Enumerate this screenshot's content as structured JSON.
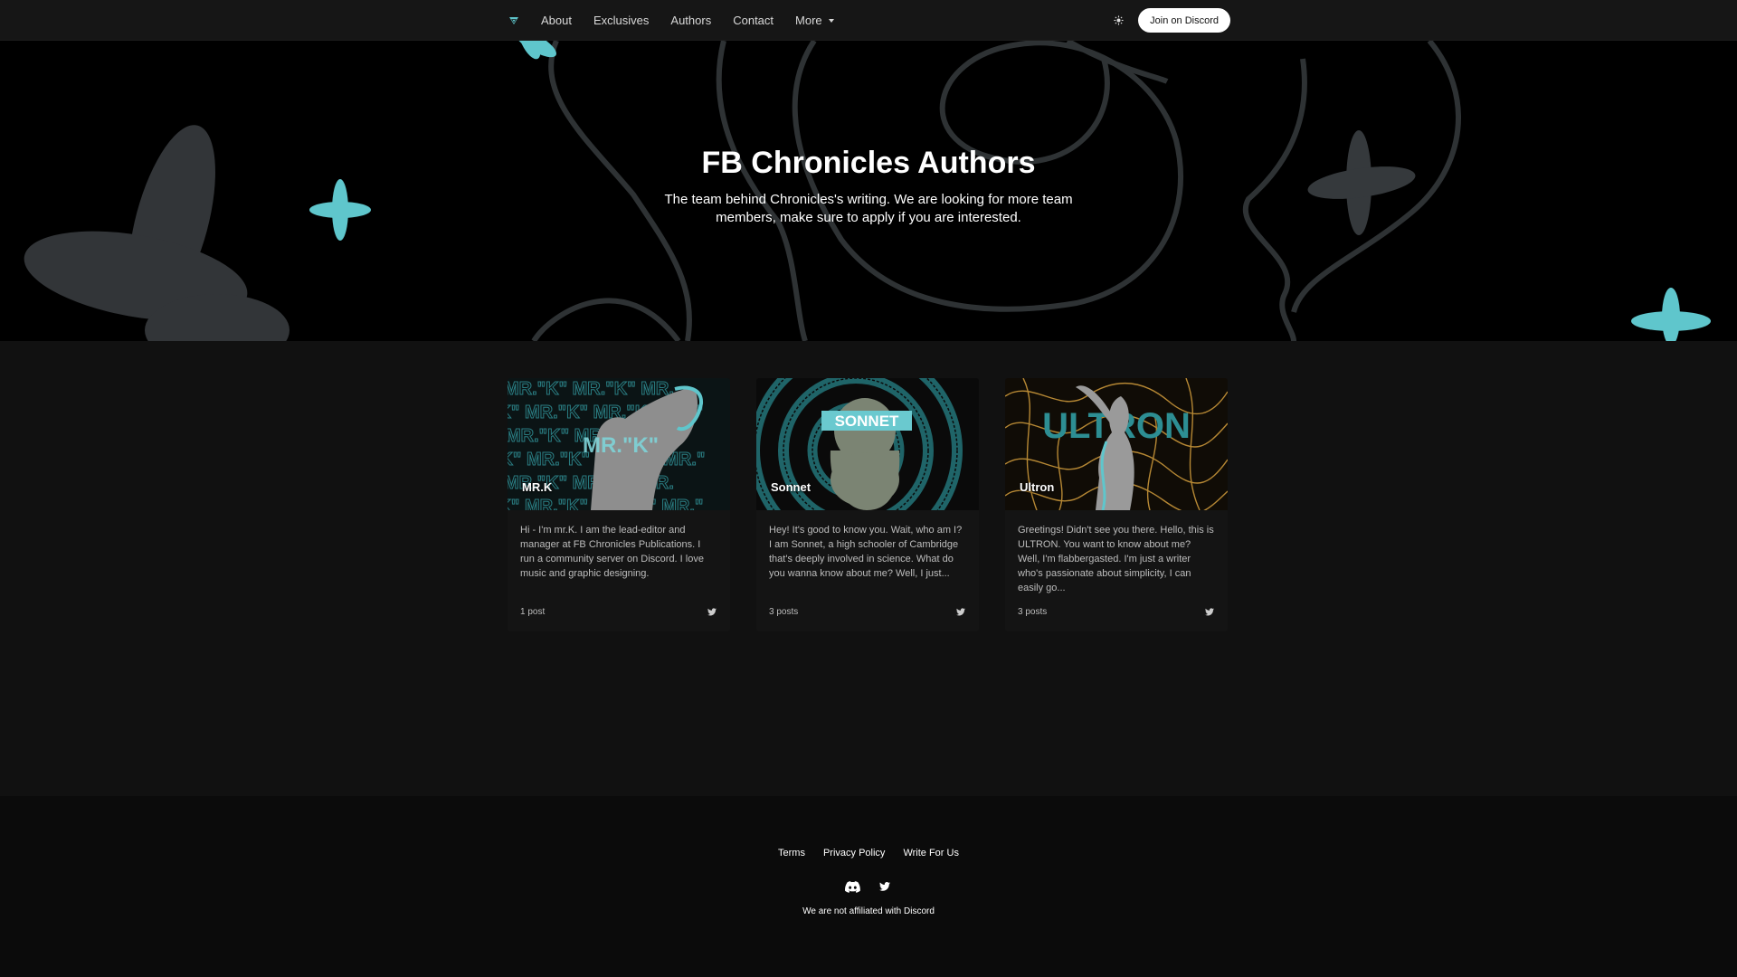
{
  "nav": {
    "logo": "logo-icon",
    "links": [
      "About",
      "Exclusives",
      "Authors",
      "Contact"
    ],
    "more_label": "More",
    "theme_icon": "sun-icon",
    "cta_label": "Join on Discord"
  },
  "hero": {
    "title": "FB Chronicles Authors",
    "subtitle": "The team behind Chronicles's writing. We are looking for more team members, make sure to apply if you are interested."
  },
  "authors": [
    {
      "name": "MR.K",
      "bio": "Hi - I'm mr.K. I am the lead-editor and manager at FB Chronicles Publications. I run a community server on Discord. I love music and graphic designing.",
      "posts": "1 post",
      "image_text": "MR.\"K\""
    },
    {
      "name": "Sonnet",
      "bio": "Hey! It's good to know you. Wait, who am I? I am Sonnet, a high schooler of Cambridge that's deeply involved in science. What do you wanna know about me? Well, I just...",
      "posts": "3 posts",
      "image_text": "SONNET"
    },
    {
      "name": "Ultron",
      "bio": "Greetings! Didn't see you there. Hello, this is ULTRON. You want to know about me? Well, I'm flabbergasted. I'm just a writer who's passionate about simplicity, I can easily go...",
      "posts": "3 posts",
      "image_text": "ULTRON"
    }
  ],
  "footer": {
    "links": [
      "Terms",
      "Privacy Policy",
      "Write For Us"
    ],
    "social": [
      "discord-icon",
      "twitter-icon"
    ],
    "note": "We are not affiliated with Discord"
  },
  "colors": {
    "accent": "#5fc6cc",
    "background": "#111111",
    "hero": "#000000",
    "gold": "#c9963a"
  }
}
